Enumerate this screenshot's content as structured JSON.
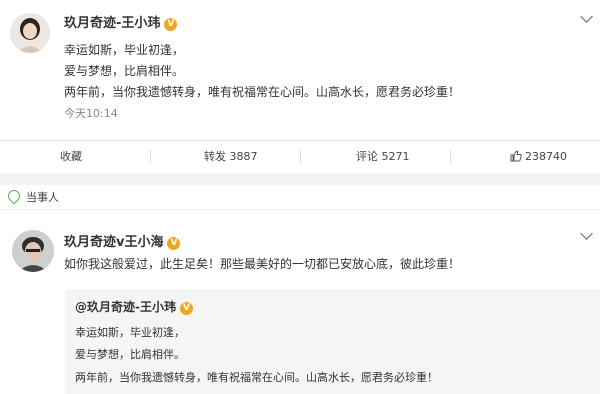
{
  "top_post": {
    "author": "玖月奇迹-王小玮",
    "verified": "V",
    "lines": [
      "幸运如斯，毕业初逢，",
      "爱与梦想，比肩相伴。",
      "两年前，当你我遗憾转身，唯有祝福常在心间。山高水长，愿君务必珍重！"
    ],
    "time": "今天10:14"
  },
  "actions": {
    "collect": "收藏",
    "repost": "转发 3887",
    "comment": "评论 5271",
    "like": "238740"
  },
  "tag": {
    "label": "当事人"
  },
  "second_post": {
    "author": "玖月奇迹v王小海",
    "verified": "V",
    "text": "如你我这般爱过，此生足矣！那些最美好的一切都已安放心底，彼此珍重！",
    "quote": {
      "author": "@玖月奇迹-王小玮",
      "verified": "V",
      "lines": [
        "幸运如斯，毕业初逢，",
        "爱与梦想，比肩相伴。",
        "两年前，当你我遗憾转身，唯有祝福常在心间。山高水长，愿君务必珍重！"
      ]
    }
  },
  "colors": {
    "accent_verified": "#f2a523",
    "tag_green": "#6ab04c",
    "gap_gray": "#f2f2f2"
  },
  "icons": [
    "avatar",
    "verified-badge-icon",
    "chevron-down-icon",
    "like-icon",
    "location-tag-icon"
  ]
}
